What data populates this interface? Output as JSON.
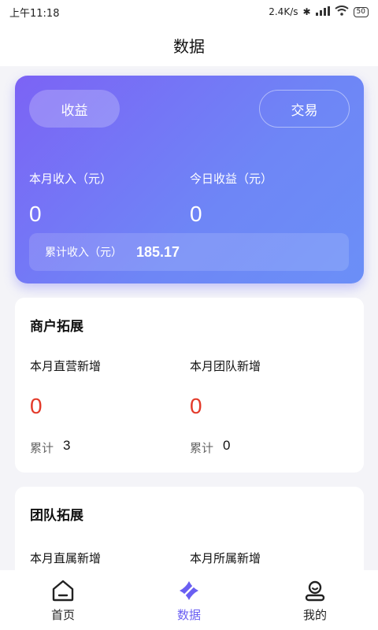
{
  "status_bar": {
    "time": "上午11:18",
    "speed": "2.4K/s",
    "battery": "50"
  },
  "header": {
    "title": "数据"
  },
  "earnings": {
    "tab_active": "收益",
    "tab_inactive": "交易",
    "month_income_label": "本月收入（元）",
    "month_income_value": "0",
    "today_earn_label": "今日收益（元）",
    "today_earn_value": "0",
    "total_label": "累计收入（元）",
    "total_value": "185.17"
  },
  "merchant": {
    "title": "商户拓展",
    "direct_label": "本月直营新增",
    "direct_value": "0",
    "team_label": "本月团队新增",
    "team_value": "0",
    "cum_label_left": "累计",
    "cum_value_left": "3",
    "cum_label_right": "累计",
    "cum_value_right": "0"
  },
  "team": {
    "title": "团队拓展",
    "direct_label": "本月直属新增",
    "subordinate_label": "本月所属新增"
  },
  "tabbar": {
    "home": "首页",
    "data": "数据",
    "mine": "我的"
  },
  "colors": {
    "accent": "#6a5ff2",
    "red": "#e33a2a"
  }
}
